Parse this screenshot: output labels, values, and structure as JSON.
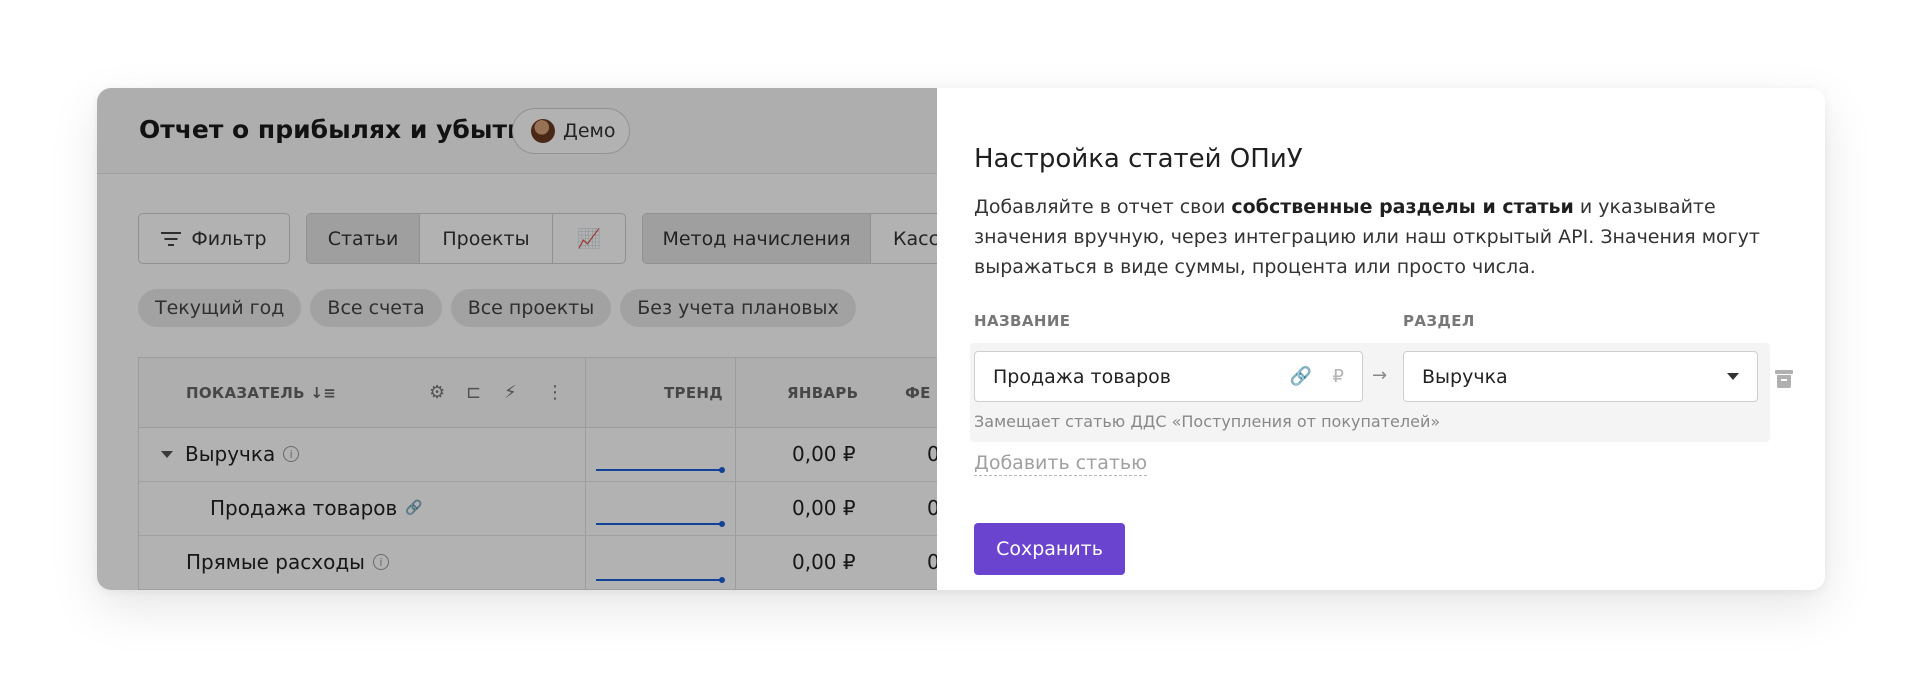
{
  "report": {
    "title": "Отчет о прибылях и убытках",
    "demo_label": "Демо",
    "toolbar": {
      "filter_label": "Фильтр",
      "view_tabs": [
        "Статьи",
        "Проекты",
        "📈"
      ],
      "method_tabs": [
        "Метод начисления",
        "Касс"
      ]
    },
    "pills": [
      "Текущий год",
      "Все счета",
      "Все проекты",
      "Без учета плановых"
    ],
    "table": {
      "headers": {
        "indicator": "ПОКАЗАТЕЛЬ",
        "trend": "ТРЕНД",
        "january": "ЯНВАРЬ",
        "february": "ФЕ"
      },
      "rows": [
        {
          "label": "Выручка",
          "jan": "0,00 ₽",
          "feb": "0"
        },
        {
          "label": "Продажа товаров",
          "jan": "0,00 ₽",
          "feb": "0"
        },
        {
          "label": "Прямые расходы",
          "jan": "0,00 ₽",
          "feb": "0"
        }
      ]
    }
  },
  "panel": {
    "title": "Настройка статей ОПиУ",
    "desc_part1": "Добавляйте в отчет свои ",
    "desc_bold": "собственные разделы и статьи",
    "desc_part2": " и указывайте значения вручную, через интеграцию или наш открытый API. Значения могут выражаться в виде суммы, процента или просто числа.",
    "name_label": "НАЗВАНИЕ",
    "section_label": "РАЗДЕЛ",
    "name_value": "Продажа товаров",
    "section_value": "Выручка",
    "hint": "Замещает статью ДДС «Поступления от покупателей»",
    "add_label": "Добавить статью",
    "save_label": "Сохранить"
  },
  "colors": {
    "accent": "#6a44cf",
    "trend": "#1a5fd6"
  }
}
